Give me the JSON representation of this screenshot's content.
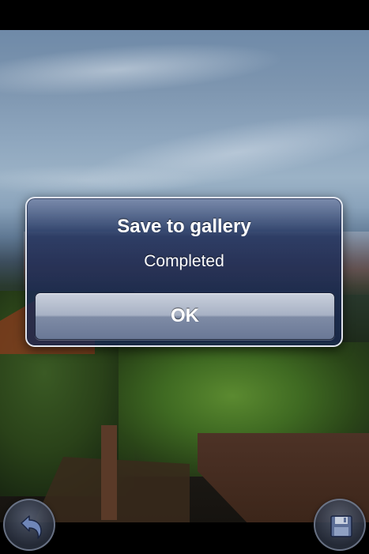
{
  "alert": {
    "title": "Save to gallery",
    "message": "Completed",
    "ok_label": "OK"
  },
  "toolbar": {
    "left_icon": "undo-arrow-icon",
    "right_icon": "floppy-disk-save-icon"
  },
  "colors": {
    "alert_background": "#1c2c58",
    "alert_border": "#ebeef5",
    "button_top": "#c9d0dc",
    "button_bottom": "#6a7896",
    "text": "#ffffff"
  }
}
